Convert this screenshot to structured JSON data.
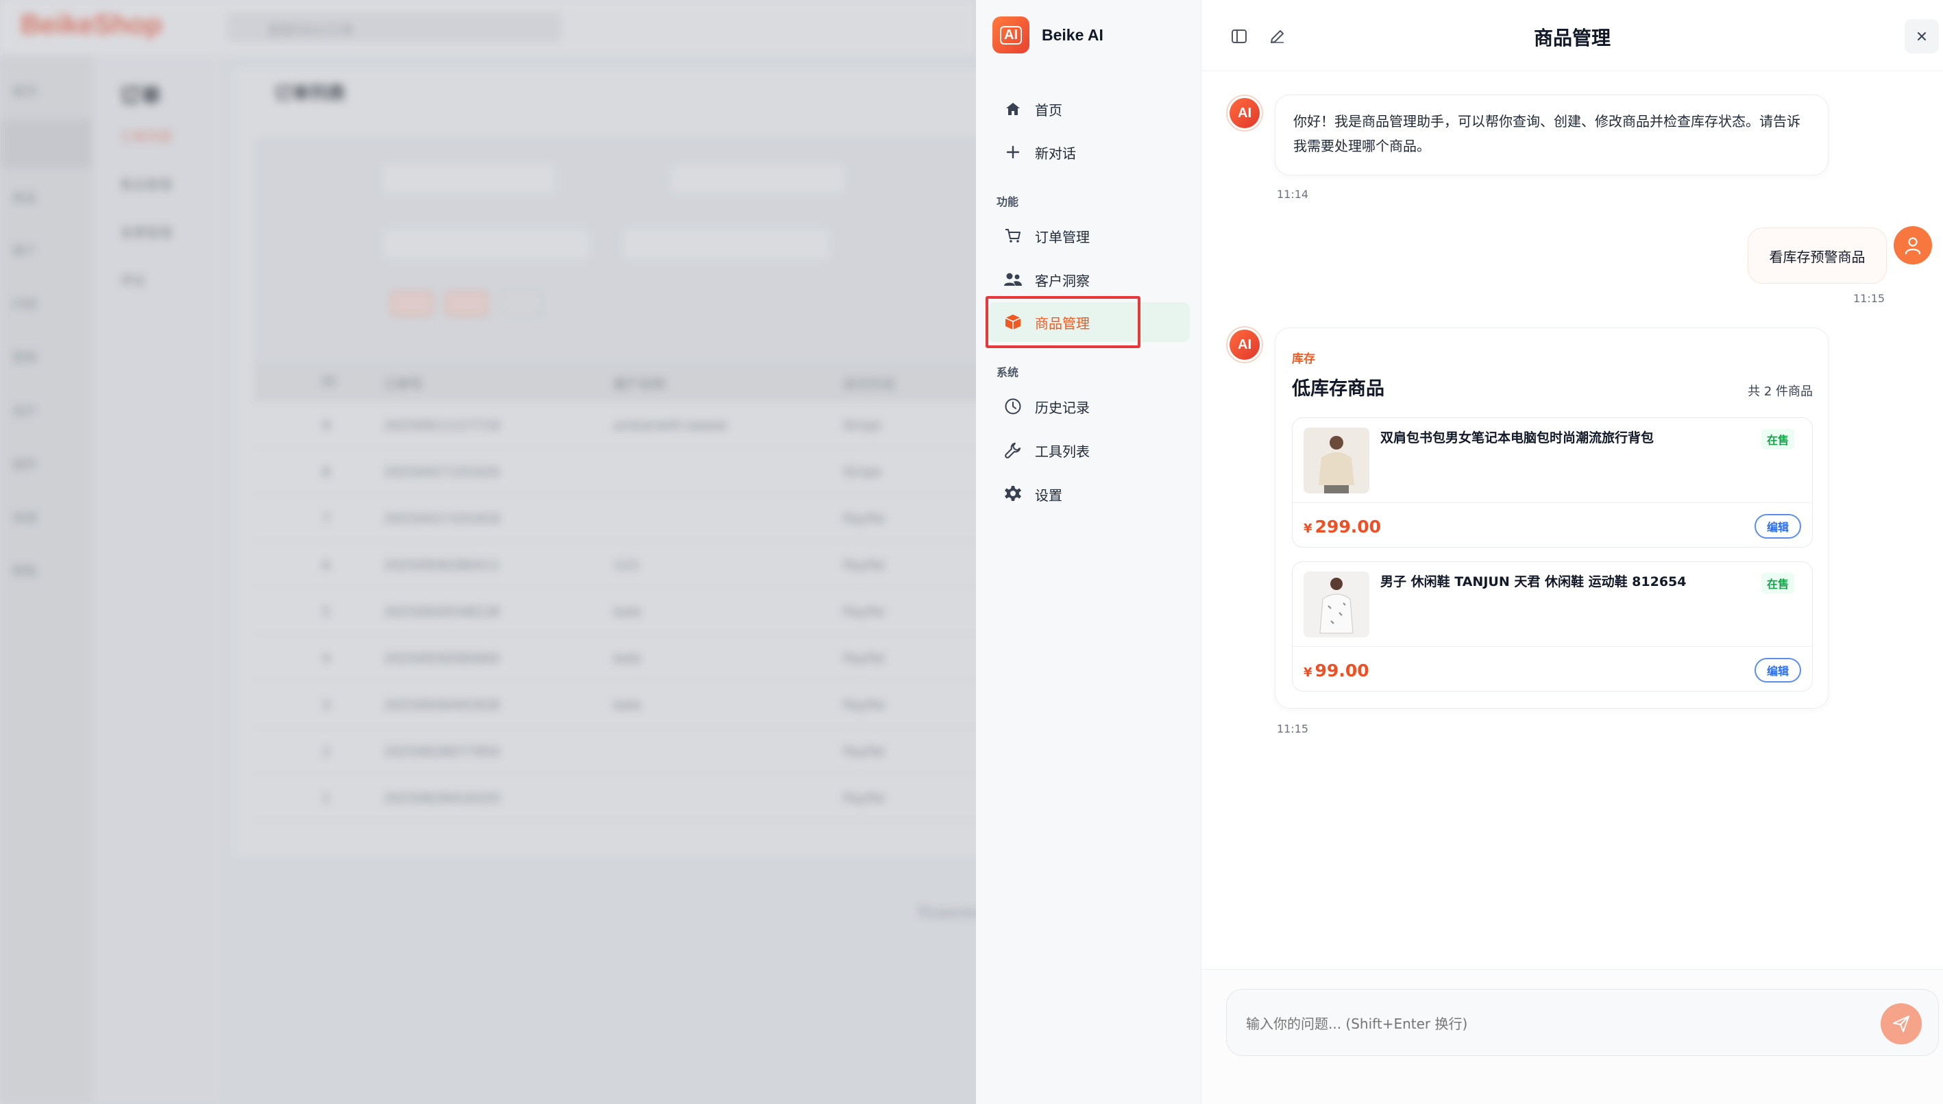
{
  "background": {
    "logo": "BeikeShop",
    "search_placeholder": "搜索SKU/订单",
    "side_items": [
      "首页",
      "订单",
      "商品",
      "客户",
      "内容",
      "营销",
      "设计",
      "插件",
      "系统",
      "帮助"
    ],
    "sub_title": "订单",
    "sub_items": [
      "订单列表",
      "售后管理",
      "发票管理",
      "评论"
    ],
    "main_title": "订单列表",
    "table_headers": [
      "ID",
      "订单号",
      "客户名称",
      "支付方式"
    ],
    "rows": [
      {
        "id": "9",
        "no": "20250911127719",
        "customer": "aristarwith.based",
        "pay": "Stripe"
      },
      {
        "id": "8",
        "no": "20250427101020",
        "customer": "",
        "pay": "Stripe"
      },
      {
        "id": "7",
        "no": "20250427101919",
        "customer": "",
        "pay": "PayPal"
      },
      {
        "id": "6",
        "no": "20250930280411",
        "customer": "123",
        "pay": "PayPal"
      },
      {
        "id": "5",
        "no": "20250930548228",
        "customer": "bale",
        "pay": "PayPal"
      },
      {
        "id": "4",
        "no": "20250930585840",
        "customer": "bale",
        "pay": "PayPal"
      },
      {
        "id": "3",
        "no": "20250930491828",
        "customer": "bale",
        "pay": "PayPal"
      },
      {
        "id": "2",
        "no": "20250628077950",
        "customer": "",
        "pay": "PayPal"
      },
      {
        "id": "1",
        "no": "20250628416320",
        "customer": "",
        "pay": "PayPal"
      }
    ],
    "footer": "Powered"
  },
  "sidebar": {
    "brand": "Beike AI",
    "logo_text": "AI",
    "home": "首页",
    "new_chat": "新对话",
    "section_features": "功能",
    "orders": "订单管理",
    "customers": "客户洞察",
    "products": "商品管理",
    "section_system": "系统",
    "history": "历史记录",
    "tools": "工具列表",
    "settings": "设置"
  },
  "chat": {
    "title": "商品管理",
    "ai_avatar_text": "AI",
    "greeting": "你好！我是商品管理助手，可以帮你查询、创建、修改商品并检查库存状态。请告诉我需要处理哪个商品。",
    "greeting_time": "11:14",
    "user_message": "看库存预警商品",
    "user_time": "11:15",
    "card": {
      "tag": "库存",
      "title": "低库存商品",
      "count": "共 2 件商品",
      "products": [
        {
          "name": "双肩包书包男女笔记本电脑包时尚潮流旅行背包",
          "status": "在售",
          "currency": "¥",
          "price": "299.00",
          "edit": "编辑"
        },
        {
          "name": "男子 休闲鞋 TANJUN 天君 休闲鞋 运动鞋 812654",
          "status": "在售",
          "currency": "¥",
          "price": "99.00",
          "edit": "编辑"
        }
      ]
    },
    "card_time": "11:15",
    "input_placeholder": "输入你的问题... (Shift+Enter 换行)"
  },
  "colors": {
    "accent": "#f05a22",
    "active_bg": "#e8f5ee",
    "status_green": "#16a34a",
    "edit_blue": "#2b6ff0",
    "highlight_red": "#e5393b"
  }
}
